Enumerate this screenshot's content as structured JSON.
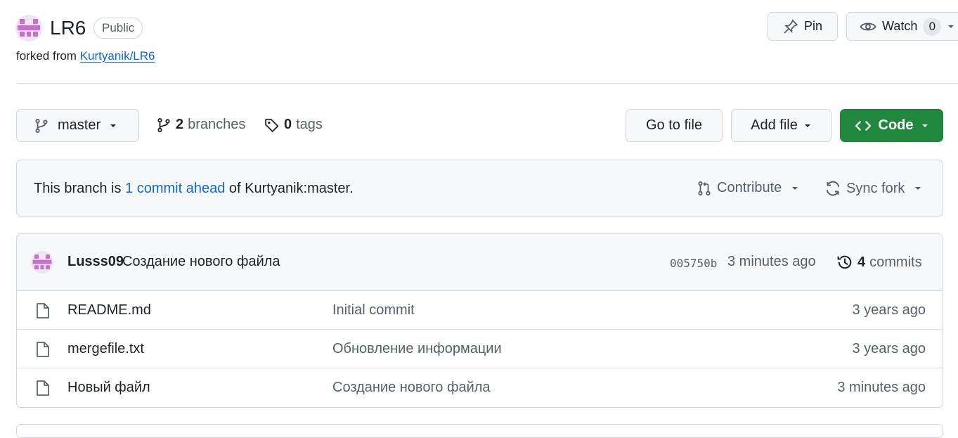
{
  "repo": {
    "name": "LR6",
    "visibility": "Public",
    "forked_prefix": "forked from",
    "forked_link": "Kurtyanik/LR6"
  },
  "header_actions": {
    "pin_label": "Pin",
    "watch_label": "Watch",
    "watch_count": "0"
  },
  "toolbar": {
    "branch": "master",
    "branches_count": "2",
    "branches_label": "branches",
    "tags_count": "0",
    "tags_label": "tags",
    "go_to_file": "Go to file",
    "add_file": "Add file",
    "code": "Code"
  },
  "fork_status": {
    "prefix": "This branch is",
    "link": "1 commit ahead",
    "suffix": "of Kurtyanik:master.",
    "contribute": "Contribute",
    "sync_fork": "Sync fork"
  },
  "latest_commit": {
    "author": "Lusss09",
    "message": "Создание нового файла",
    "sha": "005750b",
    "time": "3 minutes ago",
    "commits_count": "4",
    "commits_label": "commits"
  },
  "files": [
    {
      "name": "README.md",
      "commit": "Initial commit",
      "time": "3 years ago"
    },
    {
      "name": "mergefile.txt",
      "commit": "Обновление информации",
      "time": "3 years ago"
    },
    {
      "name": "Новый файл",
      "commit": "Создание нового файла",
      "time": "3 minutes ago"
    }
  ],
  "colors": {
    "accent_link": "#0969da",
    "code_button": "#1f883d",
    "avatar_pink": "#c86ed0"
  },
  "icons": [
    "identicon-avatar",
    "pin-icon",
    "eye-icon",
    "caret-down-icon",
    "git-branch-icon",
    "tag-icon",
    "code-icon",
    "git-pull-request-icon",
    "sync-icon",
    "history-icon",
    "file-icon"
  ]
}
